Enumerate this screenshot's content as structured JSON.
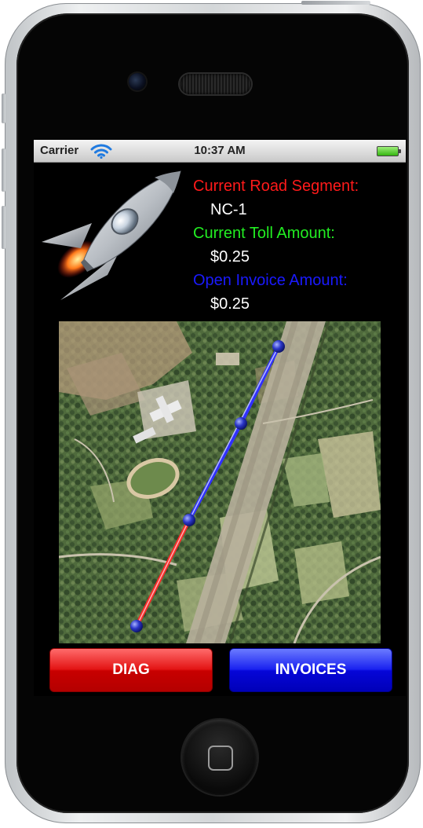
{
  "status_bar": {
    "carrier": "Carrier",
    "time": "10:37 AM",
    "wifi_icon": "wifi-icon",
    "battery_icon": "battery-icon"
  },
  "info": {
    "road_segment_label": "Current Road Segment:",
    "road_segment_value": "NC-1",
    "toll_label": "Current Toll Amount:",
    "toll_value": "$0.25",
    "invoice_label": "Open Invoice Amount:",
    "invoice_value": "$0.25"
  },
  "colors": {
    "road_segment_label": "#ff1a1a",
    "toll_label": "#22ee22",
    "invoice_label": "#1a1aff",
    "route_traveled": "#ff2a2a",
    "route_remaining": "#3030ff",
    "diag_button": "#d00000",
    "invoices_button": "#0a0ae0"
  },
  "map": {
    "type": "satellite",
    "route_points": 4
  },
  "buttons": {
    "diag": "DIAG",
    "invoices": "INVOICES"
  },
  "icons": {
    "app_logo": "rocket-icon",
    "home": "home-button-icon"
  }
}
